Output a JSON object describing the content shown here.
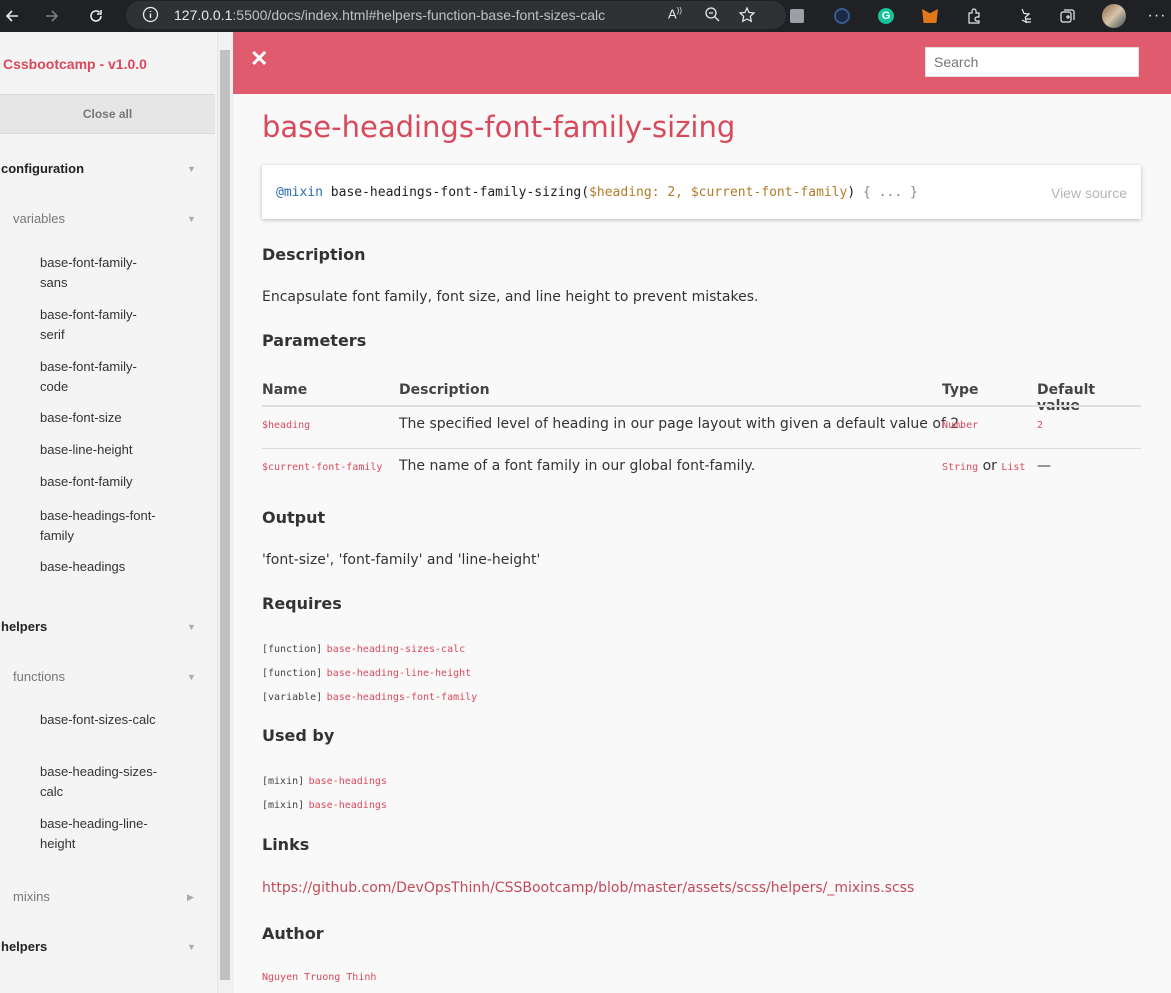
{
  "browser": {
    "url_host": "127.0.0.1",
    "url_rest": ":5500/docs/index.html#helpers-function-base-font-sizes-calc"
  },
  "sidebar": {
    "brand": "Cssbootcamp - v1.0.0",
    "close_all": "Close all",
    "sections": [
      {
        "label": "configuration"
      },
      {
        "label": "helpers"
      },
      {
        "label": "helpers"
      }
    ],
    "subsections": [
      {
        "label": "variables"
      },
      {
        "label": "functions"
      },
      {
        "label": "mixins"
      }
    ],
    "config_items": [
      "base-font-family-sans",
      "base-font-family-serif",
      "base-font-family-code",
      "base-font-size",
      "base-line-height",
      "base-font-family",
      "base-headings-font-family",
      "base-headings"
    ],
    "function_items": [
      "base-font-sizes-calc",
      "base-heading-sizes-calc",
      "base-heading-line-height"
    ]
  },
  "header": {
    "close_symbol": "✕",
    "search_placeholder": "Search"
  },
  "main": {
    "title": "base-headings-font-family-sizing",
    "signature": {
      "keyword": "@mixin",
      "name": "base-headings-font-family-sizing(",
      "param1": "$heading",
      "param1_default": ": 2, ",
      "param2": "$current-font-family",
      "close": ")",
      "body": " { ... }"
    },
    "view_source": "View source",
    "description_heading": "Description",
    "description": "Encapsulate font family, font size, and line height to prevent mistakes.",
    "parameters_heading": "Parameters",
    "table": {
      "headers": [
        "Name",
        "Description",
        "Type",
        "Default value"
      ],
      "rows": [
        {
          "name": "$heading",
          "description": "The specified level of heading in our page layout with given a default value of 2.",
          "type": "Number",
          "default": "2"
        },
        {
          "name": "$current-font-family",
          "description": "The name of a font family in our global font-family.",
          "type_a": "String",
          "type_or": " or ",
          "type_b": "List",
          "default": "—"
        }
      ]
    },
    "output_heading": "Output",
    "output": "'font-size', 'font-family' and 'line-height'",
    "requires_heading": "Requires",
    "requires": [
      {
        "kind": "[function]",
        "name": "base-heading-sizes-calc"
      },
      {
        "kind": "[function]",
        "name": "base-heading-line-height"
      },
      {
        "kind": "[variable]",
        "name": "base-headings-font-family"
      }
    ],
    "used_by_heading": "Used by",
    "used_by": [
      {
        "kind": "[mixin]",
        "name": "base-headings"
      },
      {
        "kind": "[mixin]",
        "name": "base-headings"
      }
    ],
    "links_heading": "Links",
    "link": "https://github.com/DevOpsThinh/CSSBootcamp/blob/master/assets/scss/helpers/_mixins.scss",
    "author_heading": "Author",
    "author": "Nguyen Truong Thinh"
  }
}
